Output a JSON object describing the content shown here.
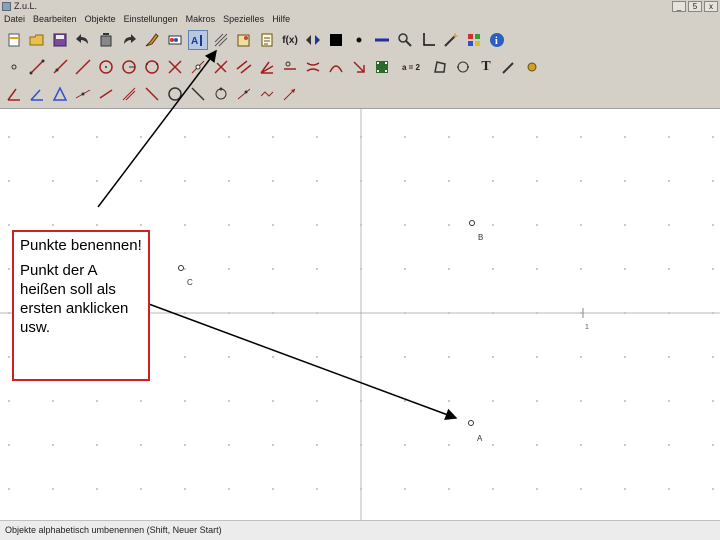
{
  "window": {
    "title": "Z.u.L."
  },
  "window_buttons": [
    "_",
    "5",
    "x"
  ],
  "menu": [
    {
      "name": "menu-datei",
      "label": "Datei"
    },
    {
      "name": "menu-bearbeiten",
      "label": "Bearbeiten"
    },
    {
      "name": "menu-objekte",
      "label": "Objekte"
    },
    {
      "name": "menu-einstellungen",
      "label": "Einstellungen"
    },
    {
      "name": "menu-makros",
      "label": "Makros"
    },
    {
      "name": "menu-spezielles",
      "label": "Spezielles"
    },
    {
      "name": "menu-hilfe",
      "label": "Hilfe"
    }
  ],
  "toolbar": {
    "function_label": "f(x)",
    "equation_label": "a = 2",
    "text_tool_label": "T"
  },
  "points": [
    {
      "name": "point-b",
      "label": "B"
    },
    {
      "name": "point-c",
      "label": "C"
    },
    {
      "name": "point-a",
      "label": "A"
    }
  ],
  "axis_tick_label": "1",
  "callout": {
    "line1": "Punkte benennen!",
    "line2": "Punkt der A heißen soll als ersten anklicken usw."
  },
  "status": {
    "text": "Objekte alphabetisch umbenennen (Shift, Neuer Start)"
  },
  "colors": {
    "callout_border": "#d02020",
    "grid": "#b8b8b8",
    "toolbar_bg": "#d4d0c8"
  }
}
